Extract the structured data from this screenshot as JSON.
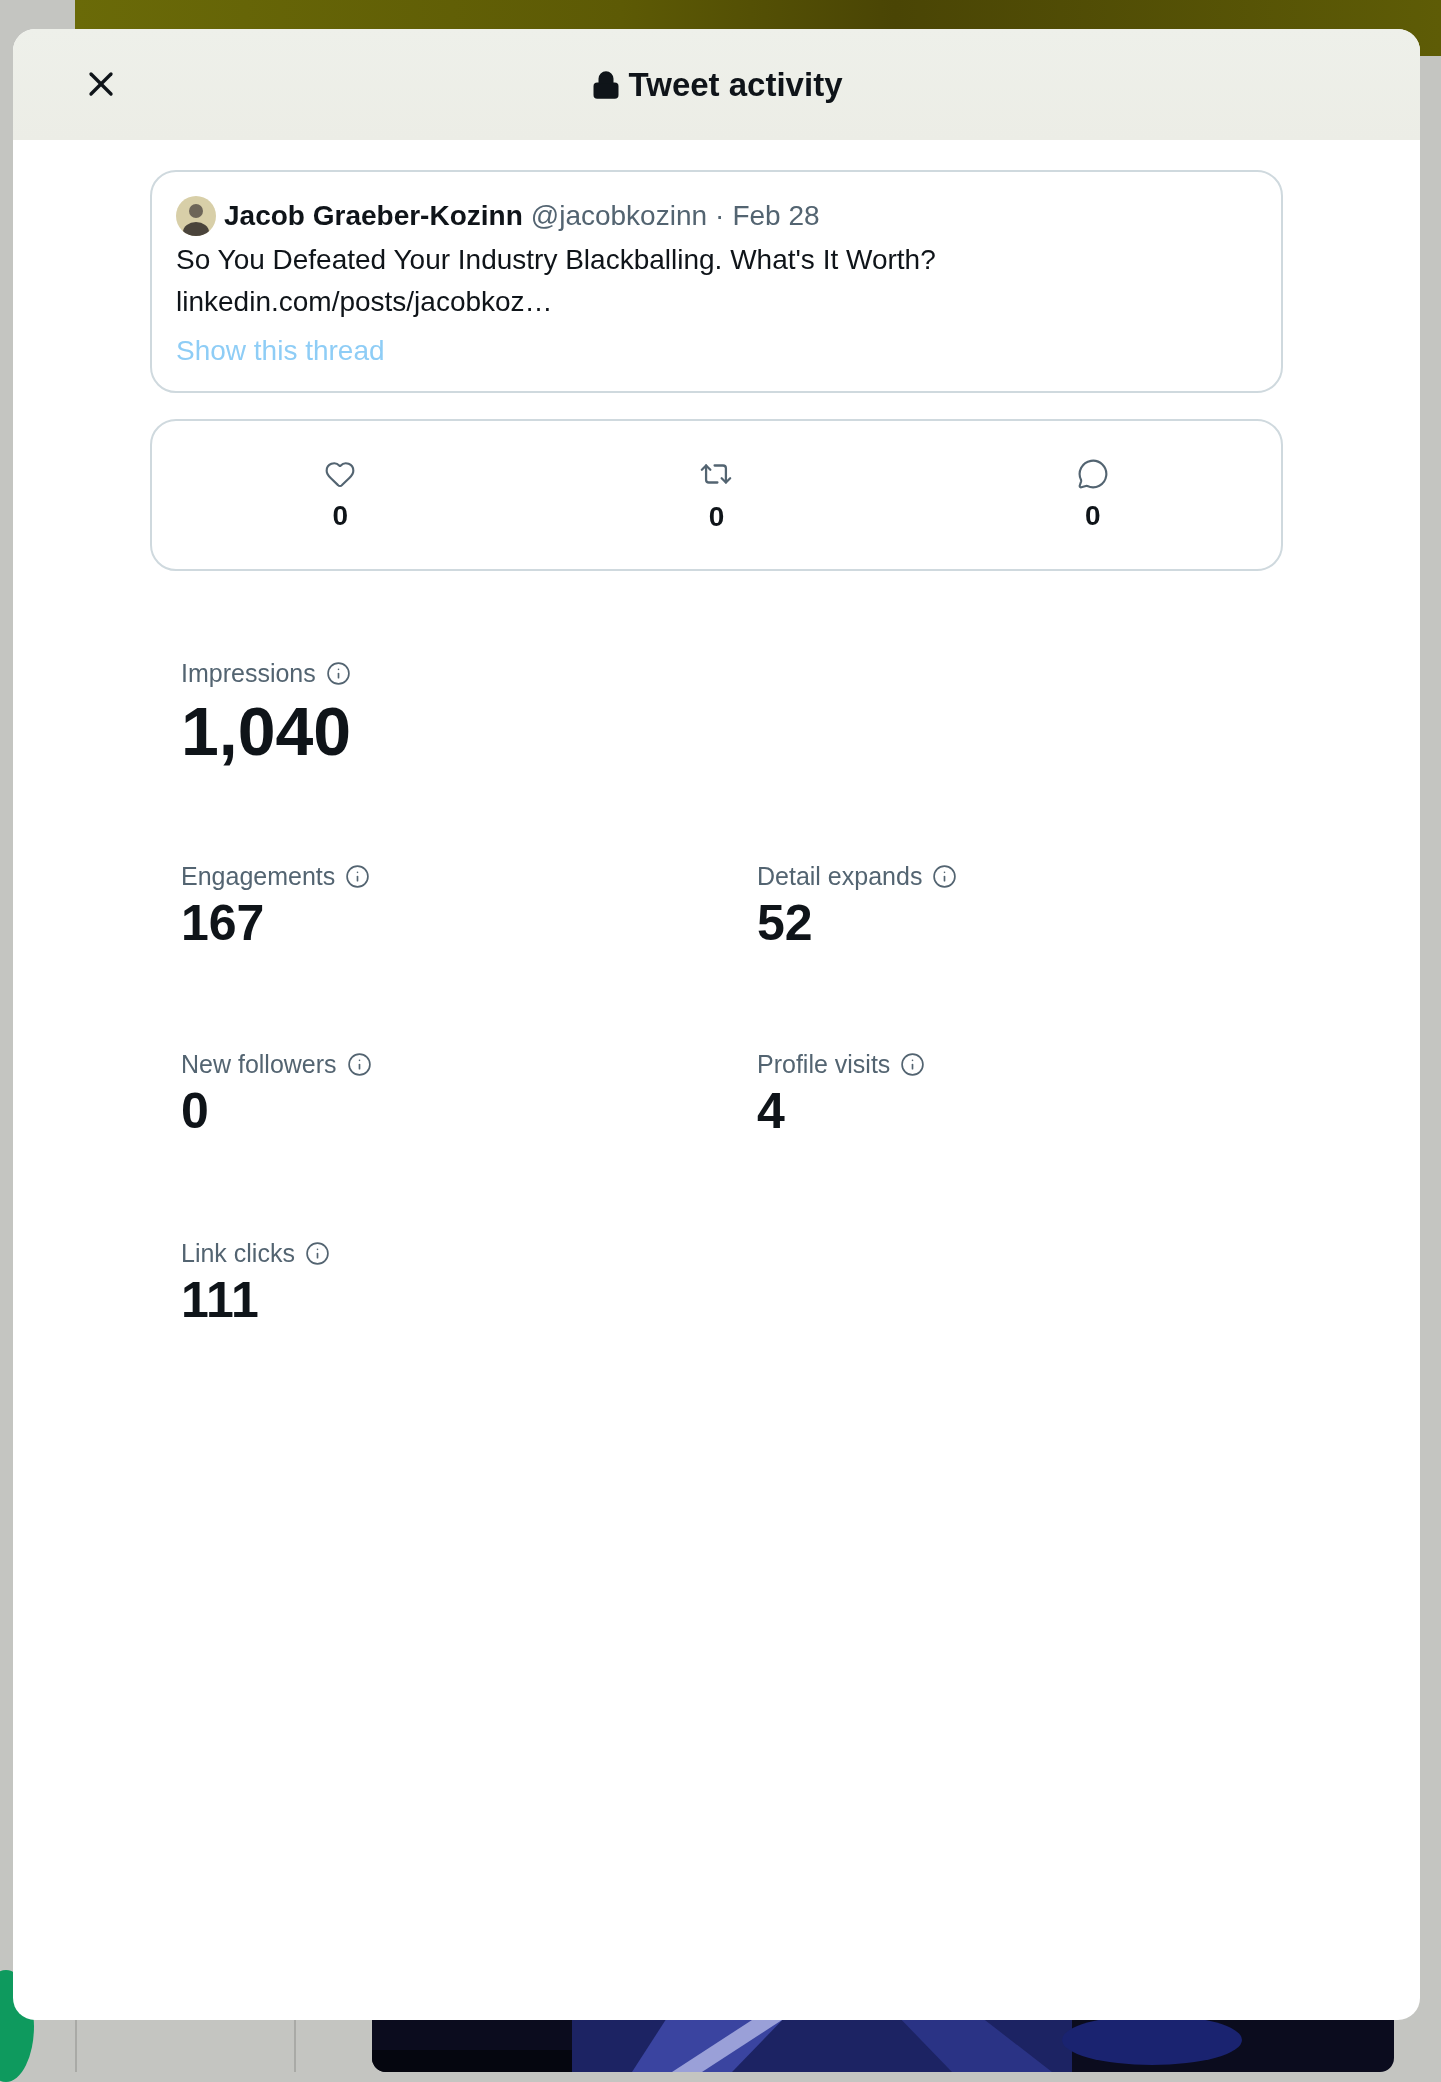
{
  "dialog": {
    "title": "Tweet activity"
  },
  "tweet": {
    "author": "Jacob Graeber-Kozinn",
    "handle": "@jacobkozinn",
    "separator": "·",
    "date": "Feb 28",
    "text": "So You Defeated Your Industry Blackballing. What's It Worth?",
    "link": "linkedin.com/posts/jacobkoz…",
    "thread_link": "Show this thread"
  },
  "engagement_counts": [
    {
      "kind": "like",
      "count": "0"
    },
    {
      "kind": "retweet",
      "count": "0"
    },
    {
      "kind": "reply",
      "count": "0"
    }
  ],
  "impressions": {
    "label": "Impressions",
    "value": "1,040"
  },
  "metrics": [
    {
      "label": "Engagements",
      "value": "167"
    },
    {
      "label": "Detail expands",
      "value": "52"
    },
    {
      "label": "New followers",
      "value": "0"
    },
    {
      "label": "Profile visits",
      "value": "4"
    },
    {
      "label": "Link clicks",
      "value": "111"
    }
  ]
}
